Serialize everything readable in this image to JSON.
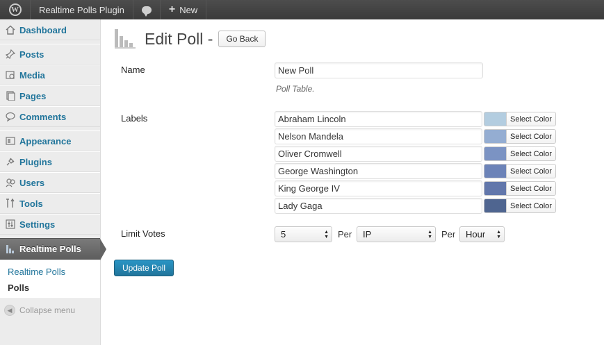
{
  "adminbar": {
    "site_name": "Realtime Polls Plugin",
    "new_label": "New"
  },
  "sidebar": {
    "items": [
      {
        "label": "Dashboard",
        "icon": "dashboard-icon"
      },
      {
        "label": "Posts",
        "icon": "pin-icon"
      },
      {
        "label": "Media",
        "icon": "media-icon"
      },
      {
        "label": "Pages",
        "icon": "pages-icon"
      },
      {
        "label": "Comments",
        "icon": "comment-icon"
      },
      {
        "label": "Appearance",
        "icon": "appearance-icon"
      },
      {
        "label": "Plugins",
        "icon": "plug-icon"
      },
      {
        "label": "Users",
        "icon": "users-icon"
      },
      {
        "label": "Tools",
        "icon": "tools-icon"
      },
      {
        "label": "Settings",
        "icon": "settings-icon"
      }
    ],
    "current": {
      "label": "Realtime Polls",
      "icon": "poll-chart-icon"
    },
    "submenu": [
      "Realtime Polls",
      "Polls"
    ],
    "active_submenu": "Polls",
    "collapse_label": "Collapse menu"
  },
  "page": {
    "title": "Edit Poll -",
    "go_back_label": "Go Back",
    "name_label": "Name",
    "name_value": "New Poll",
    "name_desc": "Poll Table.",
    "labels_label": "Labels",
    "select_color_label": "Select Color",
    "labels": [
      {
        "text": "Abraham Lincoln",
        "color": "#b3cde0"
      },
      {
        "text": "Nelson Mandela",
        "color": "#94add2"
      },
      {
        "text": "Oliver Cromwell",
        "color": "#7b93c3"
      },
      {
        "text": "George Washington",
        "color": "#6c83b8"
      },
      {
        "text": "King George IV",
        "color": "#6277ab"
      },
      {
        "text": "Lady Gaga",
        "color": "#4f6590"
      }
    ],
    "limit_votes_label": "Limit Votes",
    "limit_count": "5",
    "per_label": "Per",
    "limit_by": "IP",
    "limit_period": "Hour",
    "update_label": "Update Poll"
  },
  "colors": {
    "link": "#21759b",
    "adminbar": "#464646",
    "primary_button": "#21759b"
  }
}
